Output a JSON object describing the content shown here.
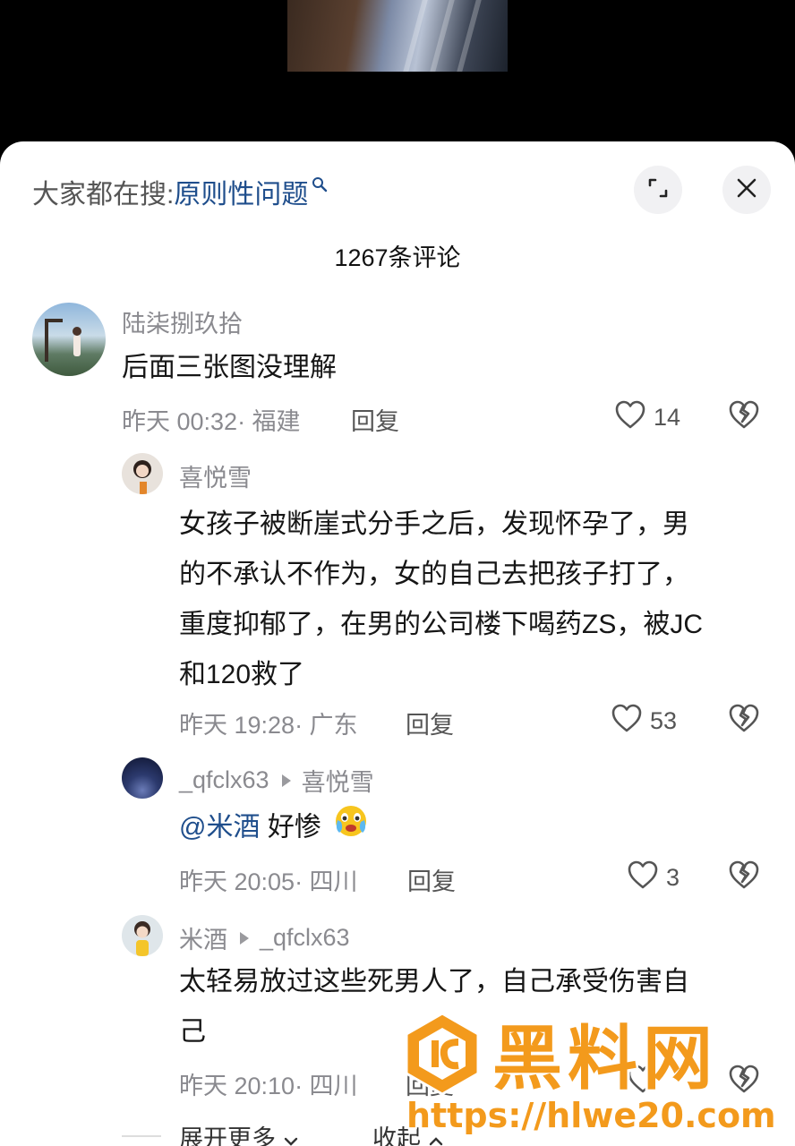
{
  "search": {
    "prefix": "大家都在搜:",
    "term": "原则性问题"
  },
  "comments_header": {
    "count_label": "1267条评论"
  },
  "comments": [
    {
      "user": "陆柒捌玖拾",
      "text": "后面三张图没理解",
      "meta": "昨天 00:32· 福建",
      "reply_label": "回复",
      "likes": "14"
    },
    {
      "user": "喜悦雪",
      "text_lines": [
        "女孩子被断崖式分手之后，发现怀孕了，男",
        "的不承认不作为，女的自己去把孩子打了，",
        "重度抑郁了，在男的公司楼下喝药ZS，被JC",
        "和120救了"
      ],
      "meta": "昨天 19:28· 广东",
      "reply_label": "回复",
      "likes": "53"
    },
    {
      "user": "_qfclx63",
      "reply_to": "喜悦雪",
      "mention": "@米酒",
      "text": "好惨",
      "meta": "昨天 20:05· 四川",
      "reply_label": "回复",
      "likes": "3"
    },
    {
      "user": "米酒",
      "reply_to": "_qfclx63",
      "text_lines": [
        "太轻易放过这些死男人了，自己承受伤害自",
        "己"
      ],
      "meta": "昨天 20:10· 四川",
      "reply_label": "回复"
    }
  ],
  "footer": {
    "expand_more": "展开更多",
    "collapse": "收起"
  },
  "watermark": {
    "title": "黑料网",
    "url": "https://hlwe20.com"
  },
  "colors": {
    "accent_blue": "#1f4e8c",
    "watermark_orange": "#f39a1c",
    "meta_gray": "#8a8a8f"
  }
}
